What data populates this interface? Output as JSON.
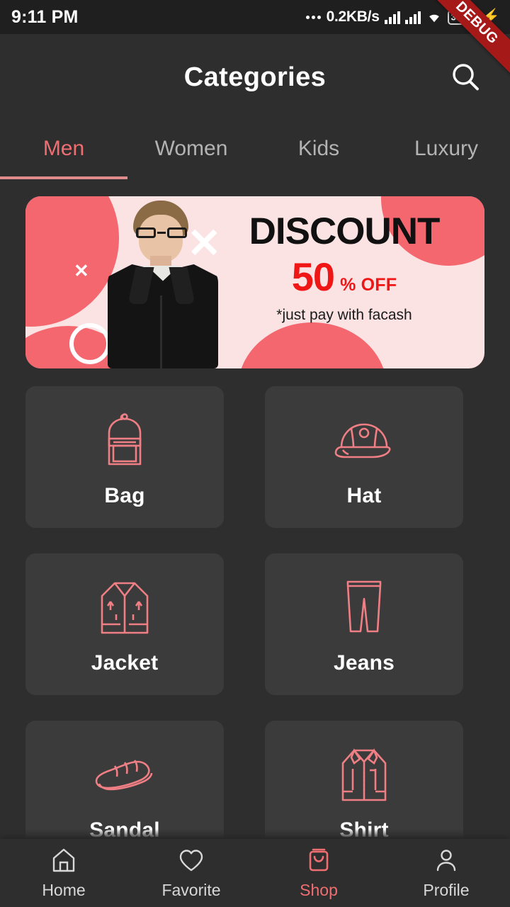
{
  "status_bar": {
    "time": "9:11 PM",
    "network_speed": "0.2KB/s",
    "battery_percent": "38",
    "icons": [
      "signal-icon",
      "signal-icon",
      "wifi-icon",
      "battery-icon",
      "charging-bolt-icon"
    ]
  },
  "debug_ribbon": {
    "label": "DEBUG"
  },
  "header": {
    "title": "Categories",
    "search_icon": "search-icon"
  },
  "tabs": {
    "items": [
      {
        "label": "Men",
        "active": true
      },
      {
        "label": "Women",
        "active": false
      },
      {
        "label": "Kids",
        "active": false
      },
      {
        "label": "Luxury",
        "active": false
      }
    ]
  },
  "banner": {
    "headline": "DISCOUNT",
    "amount": "50",
    "amount_suffix": "% OFF",
    "note": "*just pay with facash"
  },
  "categories": [
    {
      "label": "Bag",
      "icon": "backpack-icon"
    },
    {
      "label": "Hat",
      "icon": "cap-icon"
    },
    {
      "label": "Jacket",
      "icon": "jacket-icon"
    },
    {
      "label": "Jeans",
      "icon": "jeans-icon"
    },
    {
      "label": "Sandal",
      "icon": "sandal-icon"
    },
    {
      "label": "Shirt",
      "icon": "shirt-icon"
    }
  ],
  "bottom_nav": [
    {
      "label": "Home",
      "icon": "home-icon",
      "active": false
    },
    {
      "label": "Favorite",
      "icon": "heart-icon",
      "active": false
    },
    {
      "label": "Shop",
      "icon": "shopping-bag-icon",
      "active": true
    },
    {
      "label": "Profile",
      "icon": "person-icon",
      "active": false
    }
  ],
  "colors": {
    "accent": "#ef6e72",
    "icon_outline": "#ef7f84",
    "background": "#2e2e2e",
    "card": "#3b3b3b",
    "status_bar": "#1f1f1f",
    "banner_bg": "#fbe3e4",
    "banner_blob": "#f4676f",
    "discount_red": "#f01616",
    "debug_red": "#a51919",
    "battery_green": "#4caf50"
  }
}
